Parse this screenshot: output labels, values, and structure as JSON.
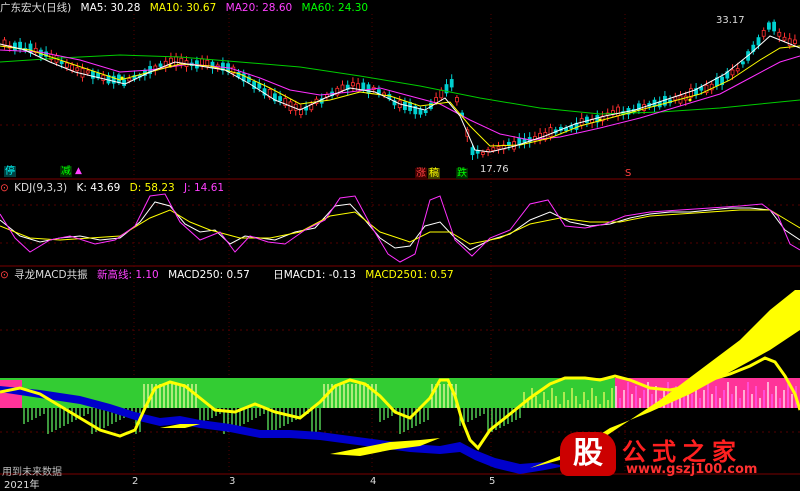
{
  "main_panel": {
    "title": "广东宏大(日线)",
    "ma": [
      {
        "label": "MA5: 30.28",
        "color": "#ffffff"
      },
      {
        "label": "MA10: 30.67",
        "color": "#ffff00"
      },
      {
        "label": "MA20: 28.60",
        "color": "#ff40ff"
      },
      {
        "label": "MA60: 24.30",
        "color": "#00ff00"
      }
    ],
    "high_label": "33.17",
    "low_label": "17.76",
    "signal_tags": [
      {
        "text": "停",
        "color": "#00ffff",
        "bg": "#004040"
      },
      {
        "text": "减",
        "color": "#00ff00",
        "bg": "#003000"
      },
      {
        "text": "涨",
        "color": "#ff4040",
        "bg": "#400000"
      },
      {
        "text": "稿",
        "color": "#ffff00",
        "bg": "#404000"
      },
      {
        "text": "跌",
        "color": "#00ff00",
        "bg": "#003000"
      },
      {
        "text": "S",
        "color": "#ff4040",
        "bg": "#000000"
      }
    ]
  },
  "kdj_panel": {
    "title": "KDJ(9,3,3)",
    "k": "K: 43.69",
    "d": "D: 58.23",
    "j": "J: 14.61"
  },
  "macd_panel": {
    "title": "寻龙MACD共振",
    "items": [
      {
        "label": "新高线: 1.10",
        "color": "#ff40ff"
      },
      {
        "label": "MACD250: 0.57",
        "color": "#ffffff"
      },
      {
        "label": "日MACD1: -0.13",
        "color": "#ffffff"
      },
      {
        "label": "MACD2501: 0.57",
        "color": "#ffff00"
      }
    ],
    "footnote": "用到未来数据"
  },
  "x_axis": {
    "labels": [
      "2021年",
      "2",
      "3",
      "4",
      "5"
    ]
  },
  "watermark": {
    "mark": "股",
    "title": "公式之家",
    "url": "www.gszj100.com"
  },
  "chart_data": [
    {
      "type": "candlestick",
      "title": "广东宏大(日线)",
      "annotations": [
        "33.17",
        "17.76"
      ],
      "series": [
        {
          "name": "MA5",
          "last": 30.28
        },
        {
          "name": "MA10",
          "last": 30.67
        },
        {
          "name": "MA20",
          "last": 28.6
        },
        {
          "name": "MA60",
          "last": 24.3
        }
      ]
    },
    {
      "type": "line",
      "title": "KDJ(9,3,3)",
      "series": [
        {
          "name": "K",
          "last": 43.69
        },
        {
          "name": "D",
          "last": 58.23
        },
        {
          "name": "J",
          "last": 14.61
        }
      ]
    },
    {
      "type": "bar",
      "title": "寻龙MACD共振",
      "series": [
        {
          "name": "新高线",
          "last": 1.1
        },
        {
          "name": "MACD250",
          "last": 0.57
        },
        {
          "name": "日MACD1",
          "last": -0.13
        },
        {
          "name": "MACD2501",
          "last": 0.57
        }
      ]
    }
  ]
}
